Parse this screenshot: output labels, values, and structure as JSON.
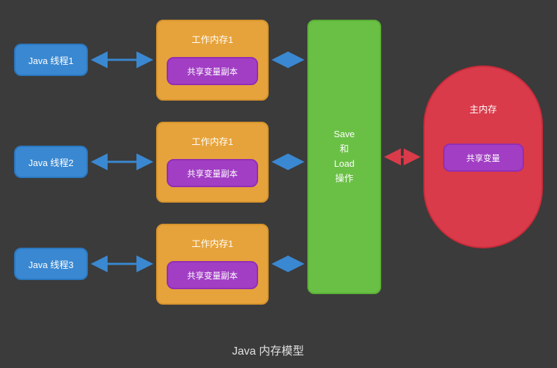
{
  "threads": [
    {
      "label": "Java 线程1"
    },
    {
      "label": "Java 线程2"
    },
    {
      "label": "Java 线程3"
    }
  ],
  "workmems": [
    {
      "title": "工作内存1",
      "copy": "共享变量副本"
    },
    {
      "title": "工作内存1",
      "copy": "共享变量副本"
    },
    {
      "title": "工作内存1",
      "copy": "共享变量副本"
    }
  ],
  "saveLoad": {
    "line1": "Save",
    "line2": "和",
    "line3": "Load",
    "line4": "操作"
  },
  "mainMem": {
    "title": "主内存",
    "sharedVar": "共享变量"
  },
  "caption": "Java 内存模型",
  "colors": {
    "blueArrow": "#3a88d1",
    "redArrow": "#d93b4a"
  }
}
